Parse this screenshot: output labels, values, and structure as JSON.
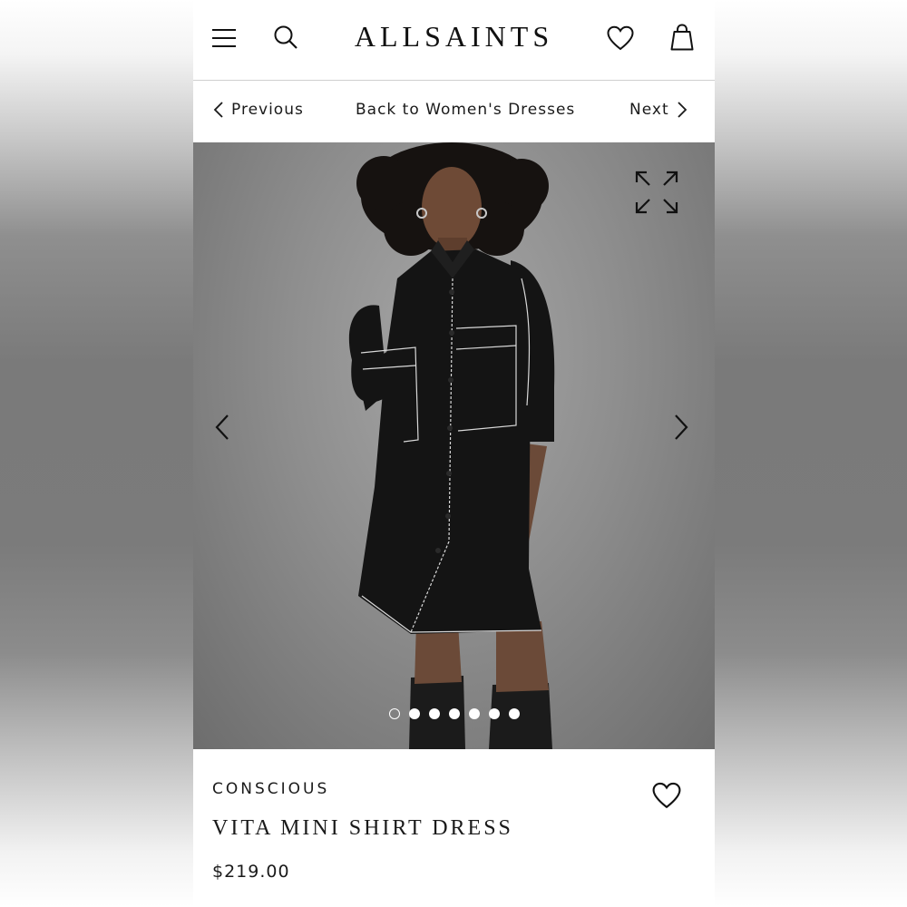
{
  "header": {
    "logo": "ALLSAINTS",
    "menu_icon": "hamburger-menu-icon",
    "search_icon": "search-icon",
    "wishlist_icon": "heart-icon",
    "bag_icon": "shopping-bag-icon"
  },
  "nav": {
    "previous_label": "Previous",
    "back_label": "Back to Women's Dresses",
    "next_label": "Next"
  },
  "gallery": {
    "expand_icon": "expand-icon",
    "prev_icon": "chevron-left-icon",
    "next_icon": "chevron-right-icon",
    "image_count": 7,
    "active_index": 0
  },
  "product": {
    "category": "CONSCIOUS",
    "title": "VITA MINI SHIRT DRESS",
    "price": "$219.00",
    "wishlist_icon": "heart-icon"
  },
  "colors": {
    "text": "#1a1a1a",
    "background": "#ffffff",
    "photo_backdrop": "#8e8e8e",
    "dress": "#141414",
    "stitching": "#d9d9d9"
  }
}
